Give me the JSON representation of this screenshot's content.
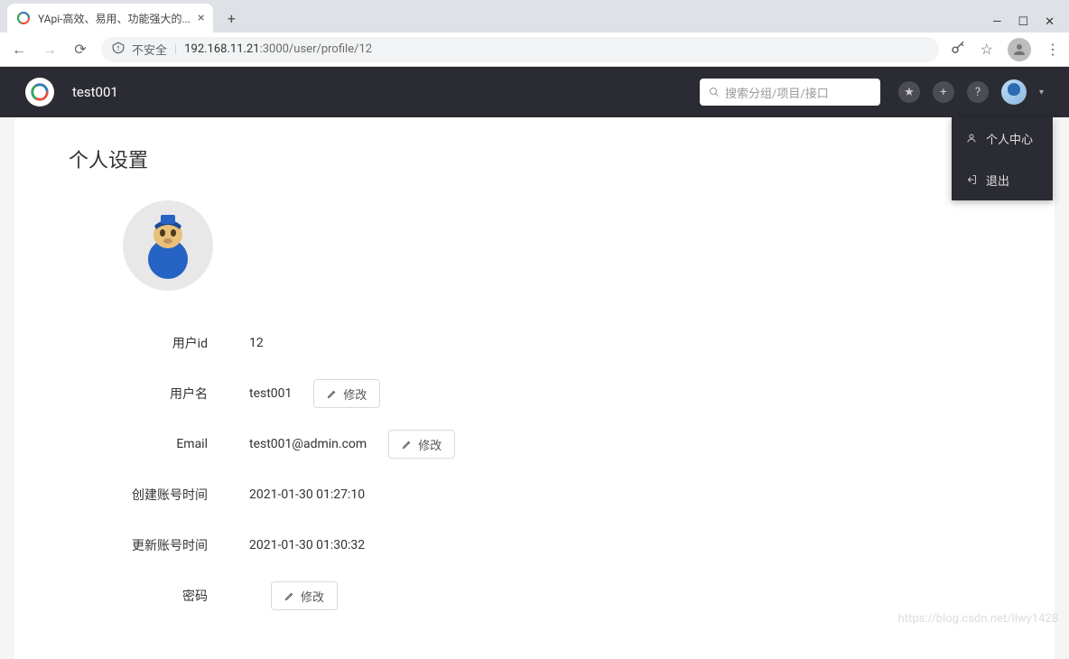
{
  "browser": {
    "tab_title": "YApi-高效、易用、功能强大的...",
    "not_secure_label": "不安全",
    "url_host": "192.168.11.21",
    "url_port_path": ":3000/user/profile/12"
  },
  "header": {
    "breadcrumb": "test001",
    "search_placeholder": "搜索分组/项目/接口"
  },
  "dropdown": {
    "profile": "个人中心",
    "logout": "退出"
  },
  "page": {
    "title": "个人设置",
    "fields": {
      "user_id": {
        "label": "用户id",
        "value": "12"
      },
      "username": {
        "label": "用户名",
        "value": "test001"
      },
      "email": {
        "label": "Email",
        "value": "test001@admin.com"
      },
      "created": {
        "label": "创建账号时间",
        "value": "2021-01-30 01:27:10"
      },
      "updated": {
        "label": "更新账号时间",
        "value": "2021-01-30 01:30:32"
      },
      "password": {
        "label": "密码",
        "value": ""
      }
    },
    "edit_label": "修改"
  },
  "watermark": "https://blog.csdn.net/llwy1428"
}
